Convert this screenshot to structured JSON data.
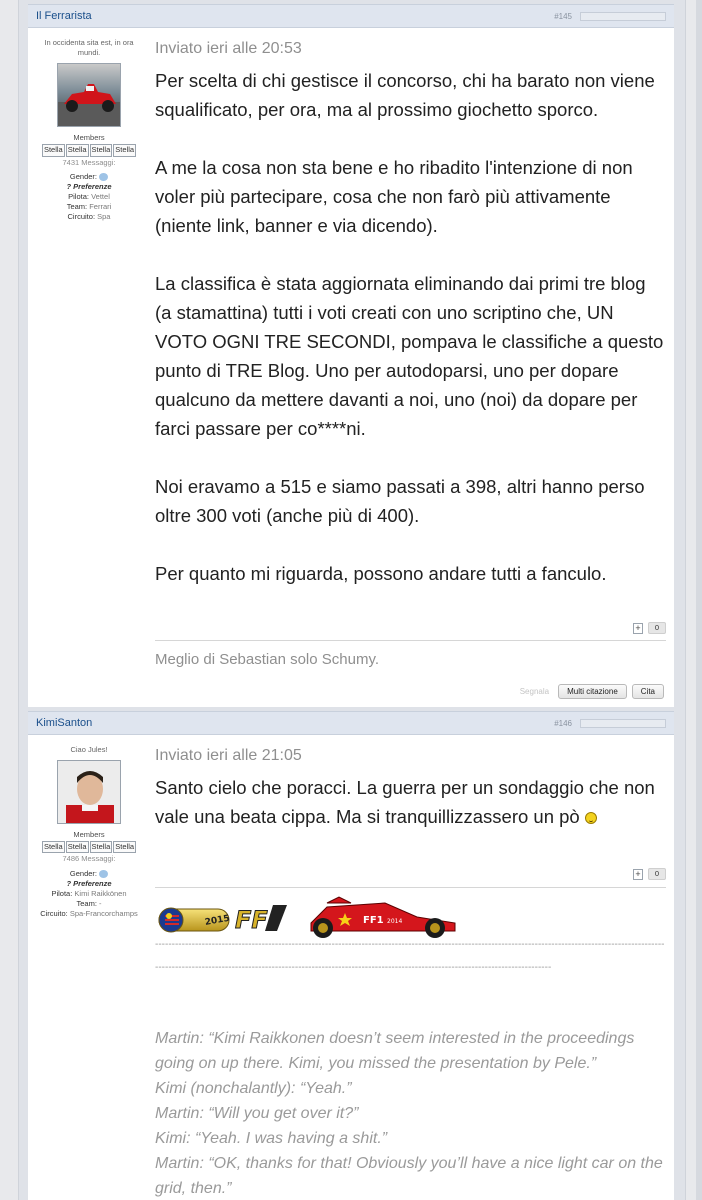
{
  "colors": {
    "accent": "#1a4f8b",
    "header_bg": "#dfe5ef"
  },
  "posts": [
    {
      "author": "Il Ferrarista",
      "post_number": "#145",
      "tagline": "In occidenta sita est, in ora mundi.",
      "group": "Members",
      "stars": [
        "Stella",
        "Stella",
        "Stella",
        "Stella"
      ],
      "messages": "7431 Messaggi:",
      "gender_label": "Gender:",
      "preferences_label": "? Preferenze",
      "pilot_label": "Pilota:",
      "pilot": "Vettel",
      "team_label": "Team:",
      "team": "Ferrari",
      "circuit_label": "Circuito:",
      "circuit": "Spa",
      "date": "Inviato ieri alle 20:53",
      "paragraphs": [
        "Per scelta di chi gestisce il concorso, chi ha barato non viene squalificato, per ora, ma al prossimo giochetto sporco.",
        "A me la cosa non sta bene e ho ribadito l'intenzione di non voler più partecipare, cosa che non farò più attivamente (niente link, banner e via dicendo).",
        "La classifica è stata aggiornata eliminando dai primi tre blog (a stamattina) tutti i voti creati con uno scriptino che, UN VOTO OGNI TRE SECONDI, pompava le classifiche a questo punto di TRE Blog. Uno per autodoparsi, uno per dopare qualcuno da mettere davanti a noi, uno (noi) da dopare per farci passare per co****ni.",
        "Noi eravamo a 515 e siamo passati a 398, altri hanno perso oltre 300 voti (anche più di 400).",
        "Per quanto mi riguarda, possono andare tutti a fanculo."
      ],
      "rep_plus": "+",
      "rep_count": "0",
      "signature": "Meglio di Sebastian solo Schumy.",
      "report_label": "Segnala",
      "multiquote_label": "Multi citazione",
      "quote_label": "Cita"
    },
    {
      "author": "KimiSanton",
      "post_number": "#146",
      "tagline": "Ciao Jules!",
      "group": "Members",
      "stars": [
        "Stella",
        "Stella",
        "Stella",
        "Stella"
      ],
      "messages": "7486 Messaggi:",
      "gender_label": "Gender:",
      "preferences_label": "? Preferenze",
      "pilot_label": "Pilota:",
      "pilot": "Kimi Raikkönen",
      "team_label": "Team:",
      "team": "-",
      "circuit_label": "Circuito:",
      "circuit": "Spa-Francorchamps",
      "date": "Inviato ieri alle 21:05",
      "text": "Santo cielo che poracci. La guerra per un sondaggio che non vale una beata cippa. Ma si tranquillizzassero un pò",
      "rep_plus": "+",
      "rep_count": "0",
      "banner": {
        "year_text": "2015",
        "ff_text": "FF",
        "car_text": "FF1",
        "car_year": "2014"
      },
      "dashes": "--------------------------------------------------------------------------------------------------------------------------------------------------------------------------------------------------------------------------------------------------------------------------------",
      "quote_lines": [
        "Martin: “Kimi Raikkonen doesn’t seem interested in the proceedings going on up there. Kimi, you missed the presentation by Pele.”",
        "Kimi (nonchalantly): “Yeah.”",
        "Martin: “Will you get over it?”",
        "Kimi: “Yeah. I was having a shit.”",
        "Martin: “OK, thanks for that! Obviously you’ll have a nice light car on the grid, then.”"
      ]
    }
  ]
}
